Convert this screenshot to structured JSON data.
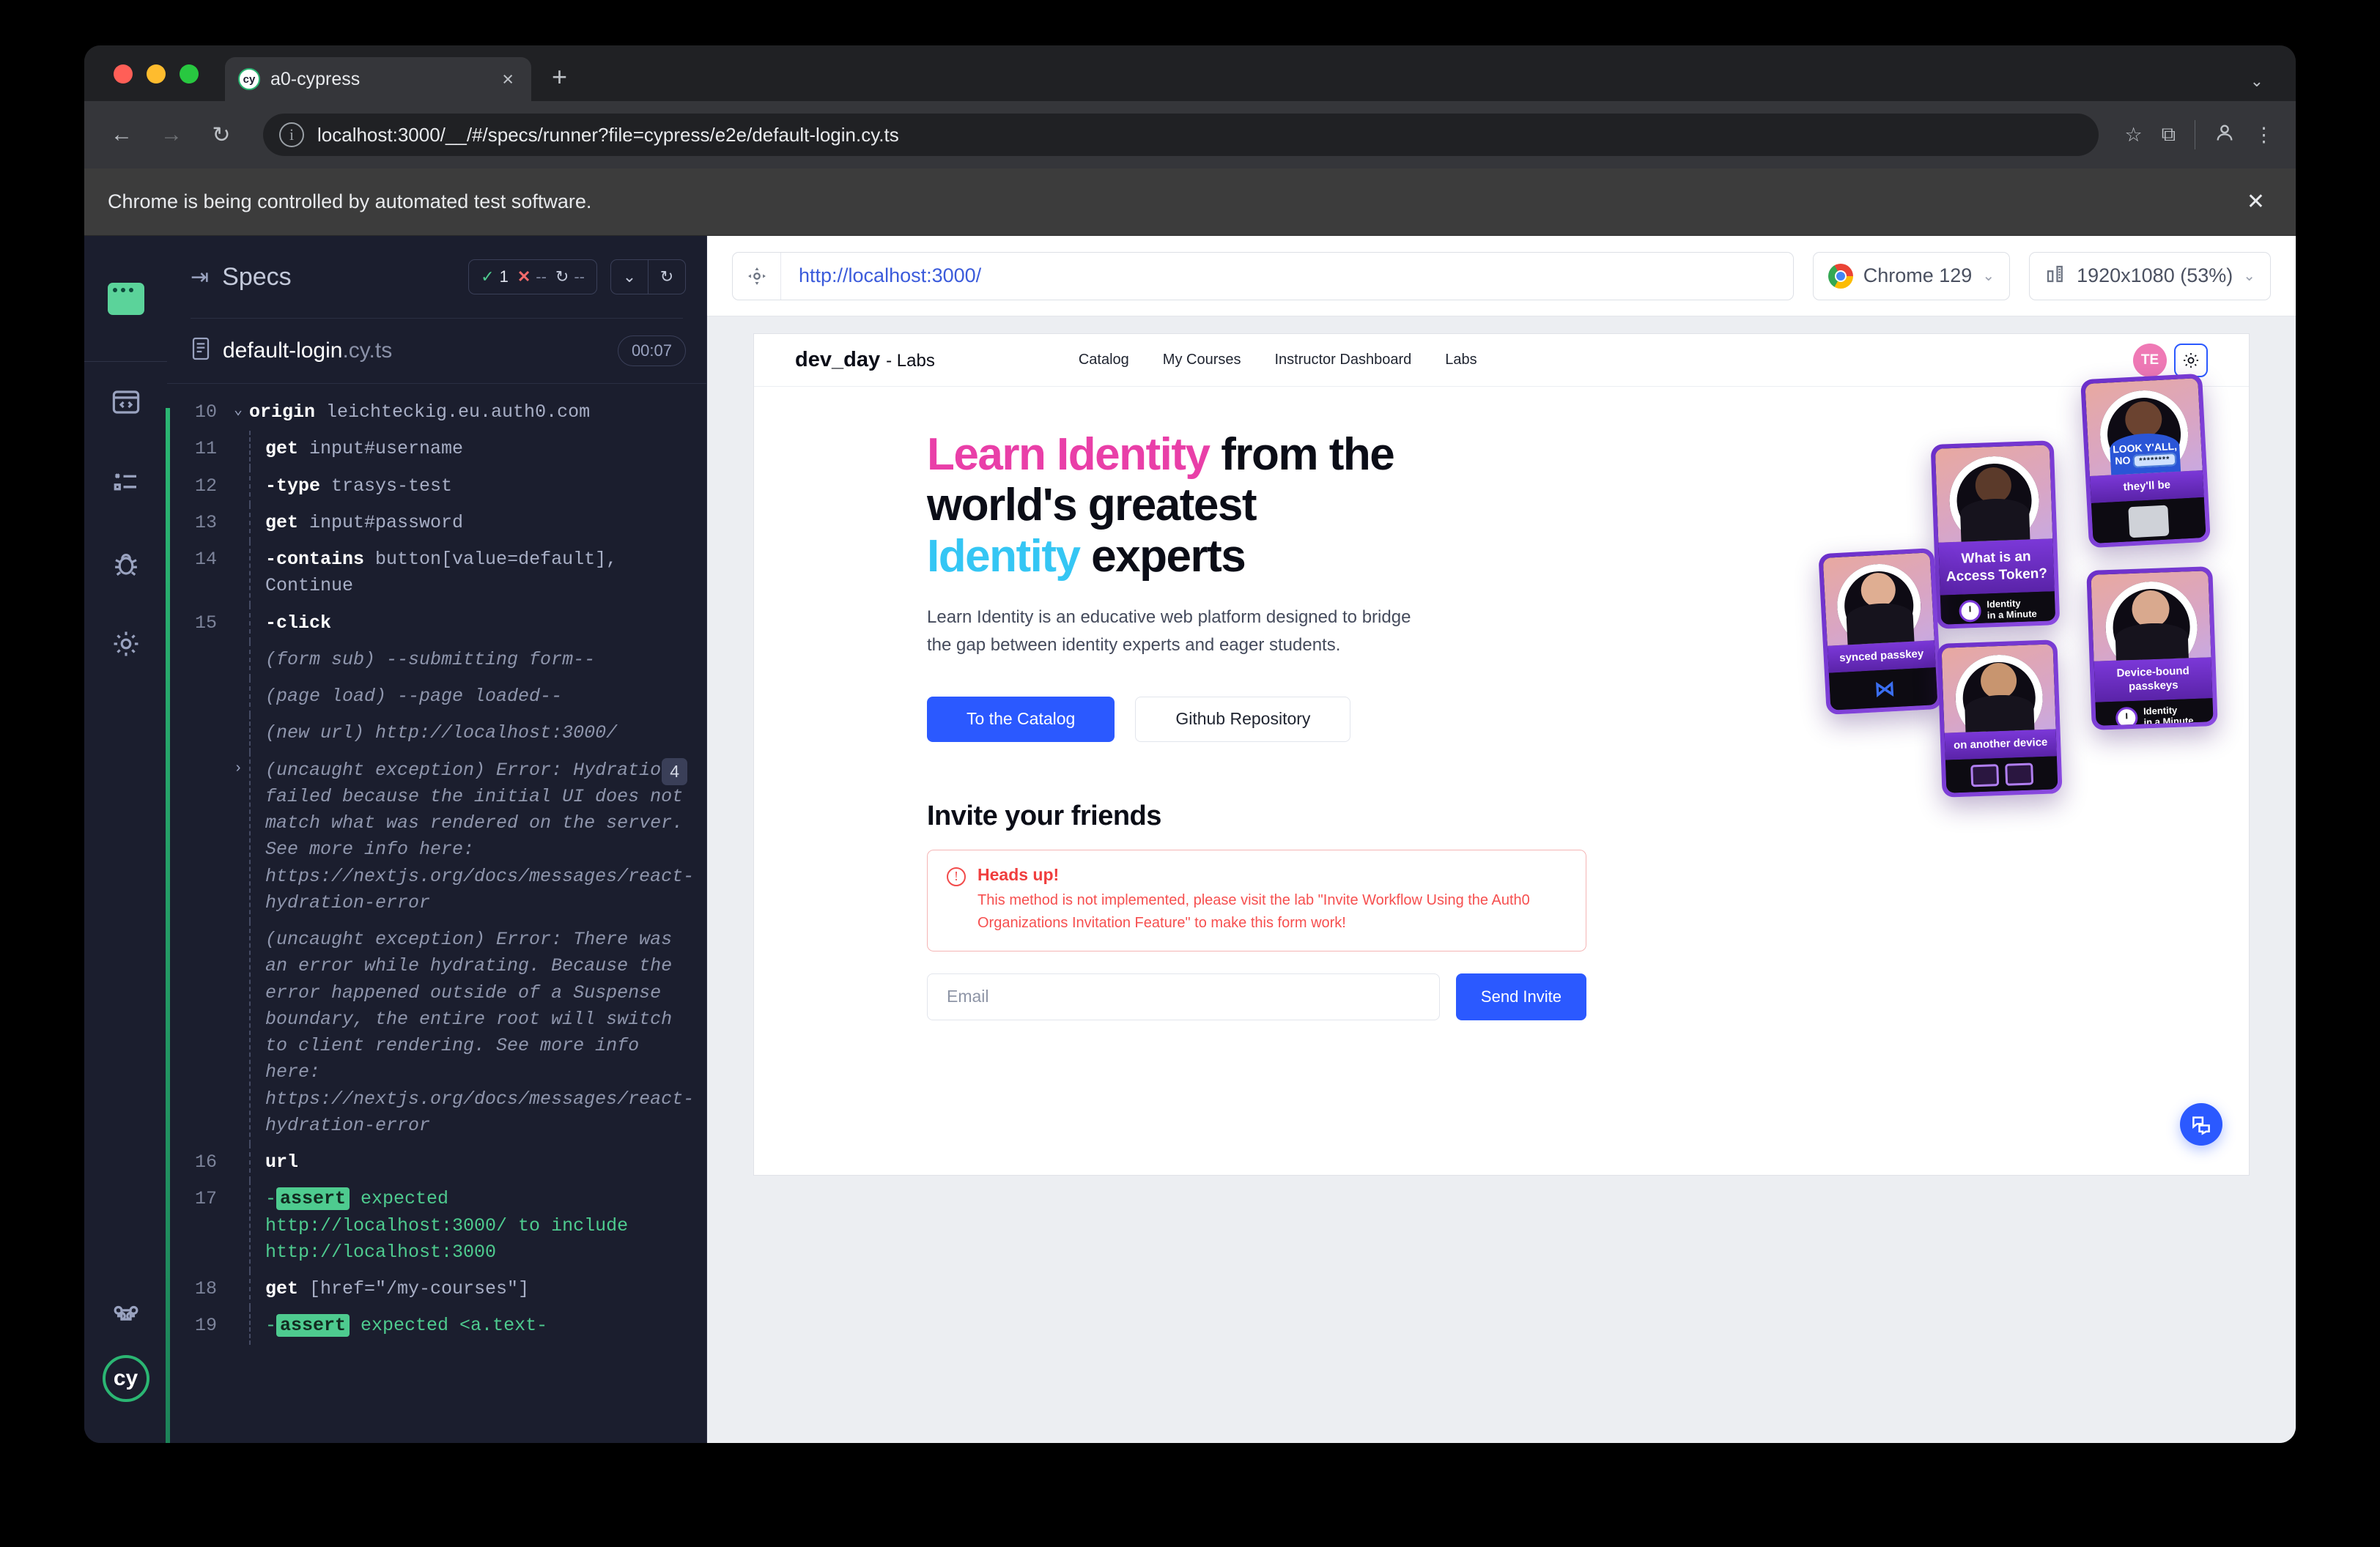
{
  "browser": {
    "tab": {
      "title": "a0-cypress",
      "favicon": "cy",
      "close_label": "×"
    },
    "new_tab_label": "+",
    "tablist_chevron": "⌄",
    "back_label": "←",
    "forward_label": "→",
    "reload_label": "↻",
    "url": "localhost:3000/__/#/specs/runner?file=cypress/e2e/default-login.cy.ts",
    "star_label": "☆",
    "extensions_label": "⧉",
    "profile_label": "●",
    "menu_label": "⋮",
    "infobar_text": "Chrome is being controlled by automated test software.",
    "infobar_close": "✕"
  },
  "rail": {
    "items": [
      {
        "name": "specs",
        "label": "Specs"
      },
      {
        "name": "runs",
        "label": "Runs"
      },
      {
        "name": "debug",
        "label": "Debug"
      },
      {
        "name": "settings",
        "label": "Settings"
      },
      {
        "name": "shortcuts",
        "label": "Keyboard Shortcuts"
      }
    ],
    "logo_label": "cy"
  },
  "specs": {
    "title": "Specs",
    "collapse_label": "⇥",
    "stats": {
      "passed_icon": "✓",
      "passed": "1",
      "failed_icon": "✕",
      "failed": "--",
      "pending_icon": "↻",
      "pending": "--"
    },
    "chevron_label": "⌄",
    "rerun_label": "↻",
    "file_base": "default-login",
    "file_ext": ".cy.ts",
    "duration": "00:07"
  },
  "command_log": [
    {
      "num": "10",
      "caret": "⌄",
      "cmd": "origin",
      "arg": "leichteckig.eu.auth0.com",
      "indent": false,
      "style": "cmd"
    },
    {
      "num": "11",
      "caret": "",
      "cmd": "get",
      "arg": "input#username",
      "indent": true,
      "style": "cmd"
    },
    {
      "num": "12",
      "caret": "",
      "cmd": "-type",
      "arg": "trasys-test",
      "indent": true,
      "style": "cmd"
    },
    {
      "num": "13",
      "caret": "",
      "cmd": "get",
      "arg": "input#password",
      "indent": true,
      "style": "cmd"
    },
    {
      "num": "14",
      "caret": "",
      "cmd": "-contains",
      "arg": "button[value=default], Continue",
      "indent": true,
      "style": "cmd"
    },
    {
      "num": "15",
      "caret": "",
      "cmd": "-click",
      "arg": "",
      "indent": true,
      "style": "cmd"
    },
    {
      "num": "",
      "caret": "",
      "cmd": "",
      "arg": "(form sub)  --submitting form--",
      "indent": true,
      "style": "muted"
    },
    {
      "num": "",
      "caret": "",
      "cmd": "",
      "arg": "(page load)  --page loaded--",
      "indent": true,
      "style": "muted"
    },
    {
      "num": "",
      "caret": "",
      "cmd": "",
      "arg": "(new url)  http://localhost:3000/",
      "indent": true,
      "style": "muted"
    },
    {
      "num": "",
      "caret": "›",
      "cmd": "",
      "arg": "(uncaught exception)  Error: Hydration failed because the initial UI does not match what was rendered on the server. See more info here: https://nextjs.org/docs/messages/react-hydration-error",
      "indent": true,
      "style": "muted",
      "badge": "4"
    },
    {
      "num": "",
      "caret": "",
      "cmd": "",
      "arg": "(uncaught exception)  Error: There was an error while hydrating. Because the error happened outside of a Suspense boundary, the entire root will switch to client rendering. See more info here: https://nextjs.org/docs/messages/react-hydration-error",
      "indent": true,
      "style": "muted"
    },
    {
      "num": "16",
      "caret": "",
      "cmd": "url",
      "arg": "",
      "indent": true,
      "style": "cmd"
    },
    {
      "num": "17",
      "caret": "",
      "cmd": "-assert",
      "arg": "expected http://localhost:3000/ to include http://localhost:3000",
      "indent": true,
      "style": "assert"
    },
    {
      "num": "18",
      "caret": "",
      "cmd": "get",
      "arg": "[href=\"/my-courses\"]",
      "indent": true,
      "style": "cmd"
    },
    {
      "num": "19",
      "caret": "",
      "cmd": "-assert",
      "arg": "expected <a.text-",
      "indent": true,
      "style": "assert"
    }
  ],
  "preview_toolbar": {
    "selector_playground_icon": "target-icon",
    "url": "http://localhost:3000/",
    "browser": "Chrome 129",
    "viewport": "1920x1080 (53%)",
    "chevron": "⌄"
  },
  "aut": {
    "brand": "dev_day",
    "brand_sub": "- Labs",
    "nav_links": [
      "Catalog",
      "My Courses",
      "Instructor Dashboard",
      "Labs"
    ],
    "avatar_initials": "TE",
    "theme_icon": "sun-icon",
    "hero": {
      "line1_accent": "Learn Identity",
      "line1_rest": " from the",
      "line2": "world's greatest",
      "line3_accent": "Identity",
      "line3_rest": " experts",
      "paragraph": "Learn Identity is an educative web platform designed to bridge the gap between identity experts and eager students.",
      "cta_primary": "To the Catalog",
      "cta_secondary": "Github Repository"
    },
    "invite": {
      "heading": "Invite your friends",
      "alert_title": "Heads up!",
      "alert_body": "This method is not implemented, please visit the lab \"Invite Workflow Using the Auth0 Organizations Invitation Feature\" to make this form work!",
      "email_placeholder": "Email",
      "email_value": "",
      "send_label": "Send Invite"
    },
    "cards": [
      {
        "caption": "synced passkey",
        "footer": "kp-logo"
      },
      {
        "caption": "What is an Access Token?",
        "footer": "Identity in a Minute"
      },
      {
        "caption": "on another device",
        "footer": "devices"
      },
      {
        "caption": "Device-bound passkeys",
        "footer": "Identity in a Minute"
      },
      {
        "caption": "they'll be",
        "shirt_line1": "LOOK Y'ALL,",
        "shirt_line2": "NO",
        "shirt_badge": "********",
        "footer": "window"
      }
    ],
    "iam_label_line1": "Identity",
    "iam_label_line2": "in a Minute",
    "chat_icon": "chat-bubbles-icon"
  },
  "colors": {
    "accent_blue": "#2b59ff",
    "pink": "#e93fa8",
    "cyan": "#35c6f4",
    "pass_green": "#4ecb8f",
    "fail_red": "#f56b6b",
    "alert_red": "#f03e3e",
    "cypress_bg": "#1b1e2e"
  }
}
